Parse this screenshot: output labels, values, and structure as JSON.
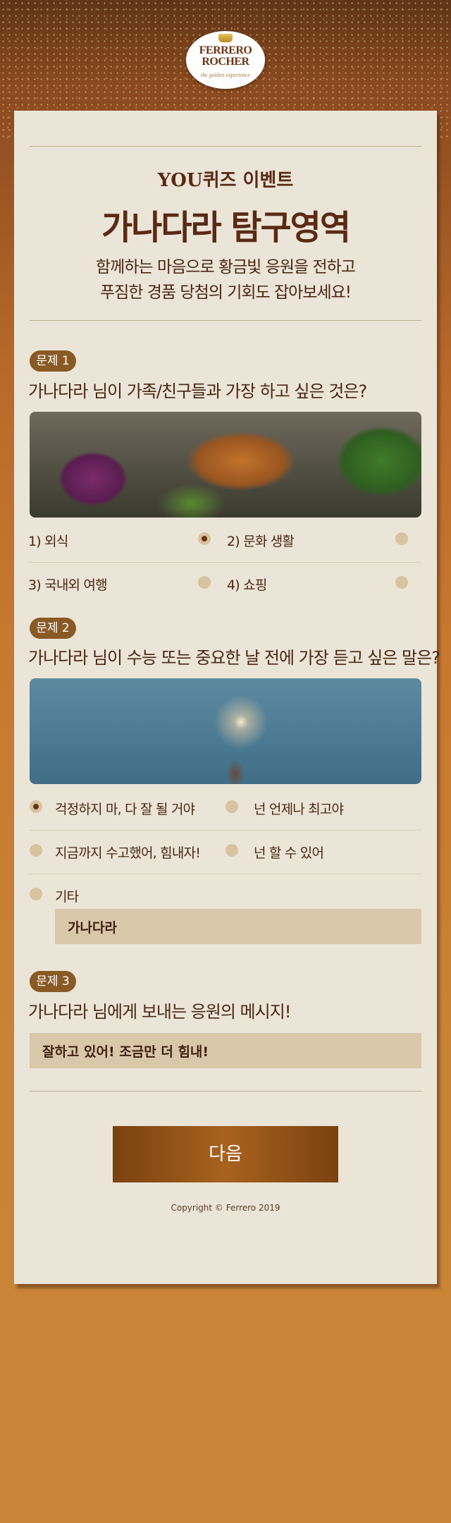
{
  "logo": {
    "brand_line1": "FERRERO",
    "brand_line2": "ROCHER",
    "tagline": "the golden experience"
  },
  "header": {
    "subtitle": "YOU퀴즈 이벤트",
    "title": "가나다라 탐구영역",
    "desc_line1": "함께하는 마음으로 황금빛 응원을 전하고",
    "desc_line2": "푸짐한 경품 당첨의 기회도 잡아보세요!"
  },
  "q1": {
    "badge": "문제 1",
    "question": "가나다라 님이 가족/친구들과 가장 하고 싶은 것은?",
    "options": [
      "1) 외식",
      "2) 문화 생활",
      "3) 국내외 여행",
      "4) 쇼핑"
    ],
    "selected": 0
  },
  "q2": {
    "badge": "문제 2",
    "question": "가나다라 님이 수능 또는 중요한 날 전에 가장 듣고 싶은 말은?",
    "options": [
      "걱정하지 마, 다 잘 될 거야",
      "넌 언제나 최고야",
      "지금까지 수고했어, 힘내자!",
      "넌 할 수 있어",
      "기타"
    ],
    "selected": 0,
    "other_value": "가나다라"
  },
  "q3": {
    "badge": "문제 3",
    "question": "가나다라 님에게 보내는 응원의 메시지!",
    "message_value": "잘하고 있어! 조금만 더 힘내!"
  },
  "next_button": "다음",
  "copyright": "Copyright © Ferrero 2019",
  "colors": {
    "accent": "#8a5a24",
    "text": "#4a2612",
    "card": "#ebe5d8",
    "button": "#9a5818"
  },
  "icons": [
    "crown-icon",
    "radio-selected-icon",
    "radio-unselected-icon"
  ]
}
